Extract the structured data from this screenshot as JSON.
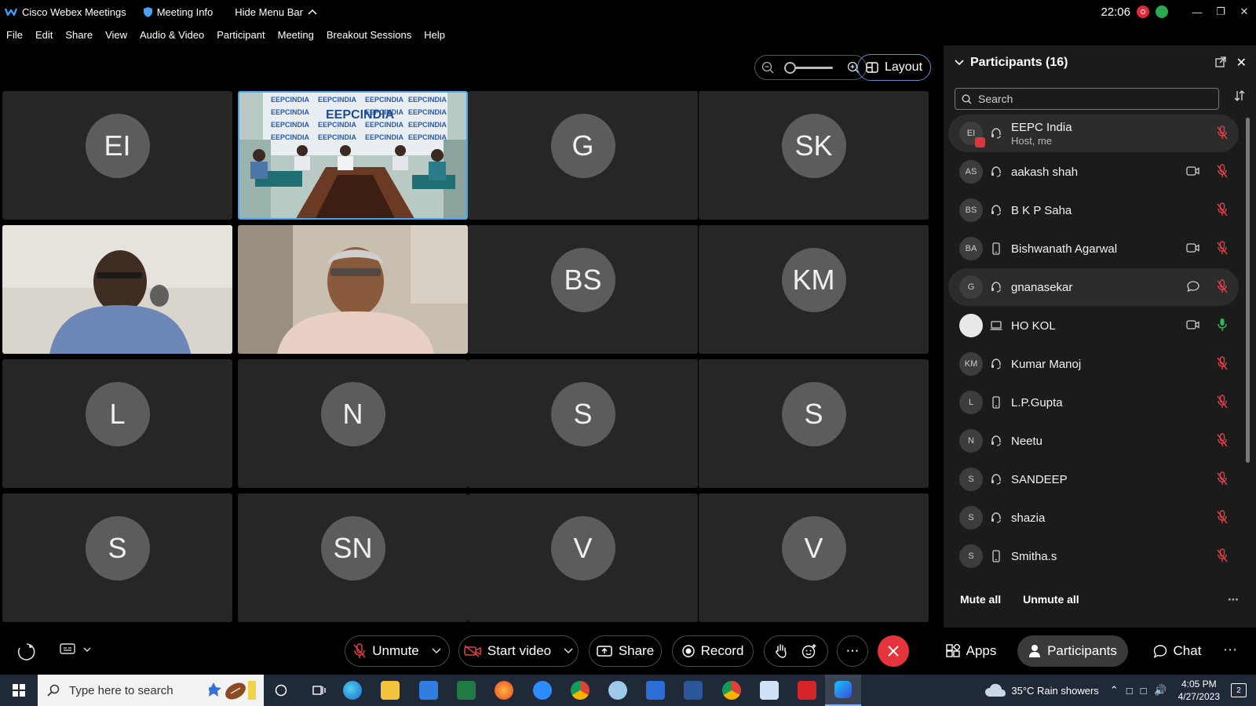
{
  "titlebar": {
    "app_name": "Cisco Webex Meetings",
    "meeting_info": "Meeting Info",
    "hide_menu": "Hide Menu Bar",
    "time": "22:06"
  },
  "menu": [
    "File",
    "Edit",
    "Share",
    "View",
    "Audio & Video",
    "Participant",
    "Meeting",
    "Breakout Sessions",
    "Help"
  ],
  "toolbar": {
    "layout_label": "Layout"
  },
  "grid": {
    "tiles": [
      {
        "initials": "EI",
        "type": "avatar"
      },
      {
        "initials": "",
        "type": "video-room"
      },
      {
        "initials": "G",
        "type": "avatar"
      },
      {
        "initials": "SK",
        "type": "avatar"
      },
      {
        "initials": "",
        "type": "video-person1"
      },
      {
        "initials": "",
        "type": "video-person2"
      },
      {
        "initials": "BS",
        "type": "avatar"
      },
      {
        "initials": "KM",
        "type": "avatar"
      },
      {
        "initials": "L",
        "type": "avatar"
      },
      {
        "initials": "N",
        "type": "avatar"
      },
      {
        "initials": "S",
        "type": "avatar"
      },
      {
        "initials": "S",
        "type": "avatar"
      },
      {
        "initials": "S",
        "type": "avatar"
      },
      {
        "initials": "SN",
        "type": "avatar"
      },
      {
        "initials": "V",
        "type": "avatar"
      },
      {
        "initials": "V",
        "type": "avatar"
      }
    ]
  },
  "panel": {
    "title": "Participants (16)",
    "search_placeholder": "Search",
    "participants": [
      {
        "initials": "EI",
        "name": "EEPC India",
        "sub": "Host, me",
        "device": "headset-icon",
        "video": "",
        "mic": "muted"
      },
      {
        "initials": "AS",
        "name": "aakash shah",
        "sub": "",
        "device": "headset-icon",
        "video": "camera-icon",
        "mic": "muted"
      },
      {
        "initials": "BS",
        "name": "B K P Saha",
        "sub": "",
        "device": "headset-icon",
        "video": "",
        "mic": "muted"
      },
      {
        "initials": "BA",
        "name": "Bishwanath Agarwal",
        "sub": "",
        "device": "phone-icon",
        "video": "camera-icon",
        "mic": "muted"
      },
      {
        "initials": "G",
        "name": "gnanasekar",
        "sub": "",
        "device": "headset-icon",
        "video": "chat-icon",
        "mic": "muted"
      },
      {
        "initials": "",
        "name": "HO KOL",
        "sub": "",
        "device": "laptop-icon",
        "video": "camera-icon",
        "mic": "active"
      },
      {
        "initials": "KM",
        "name": "Kumar Manoj",
        "sub": "",
        "device": "headset-icon",
        "video": "",
        "mic": "muted"
      },
      {
        "initials": "L",
        "name": "L.P.Gupta",
        "sub": "",
        "device": "phone-icon",
        "video": "",
        "mic": "muted"
      },
      {
        "initials": "N",
        "name": "Neetu",
        "sub": "",
        "device": "headset-icon",
        "video": "",
        "mic": "muted"
      },
      {
        "initials": "S",
        "name": "SANDEEP",
        "sub": "",
        "device": "headset-icon",
        "video": "",
        "mic": "muted"
      },
      {
        "initials": "S",
        "name": "shazia",
        "sub": "",
        "device": "headset-icon",
        "video": "",
        "mic": "muted"
      },
      {
        "initials": "S",
        "name": "Smitha.s",
        "sub": "",
        "device": "phone-icon",
        "video": "",
        "mic": "muted"
      }
    ],
    "mute_all": "Mute all",
    "unmute_all": "Unmute all"
  },
  "controls": {
    "unmute": "Unmute",
    "start_video": "Start video",
    "share": "Share",
    "record": "Record",
    "apps": "Apps",
    "participants": "Participants",
    "chat": "Chat"
  },
  "taskbar": {
    "search_placeholder": "Type here to search",
    "weather": "35°C  Rain showers",
    "time": "4:05 PM",
    "date": "4/27/2023"
  },
  "colors": {
    "accent": "#4aa3f0",
    "end_call": "#e6343c",
    "muted": "#e0404a",
    "mic_active": "#2fb85c"
  }
}
